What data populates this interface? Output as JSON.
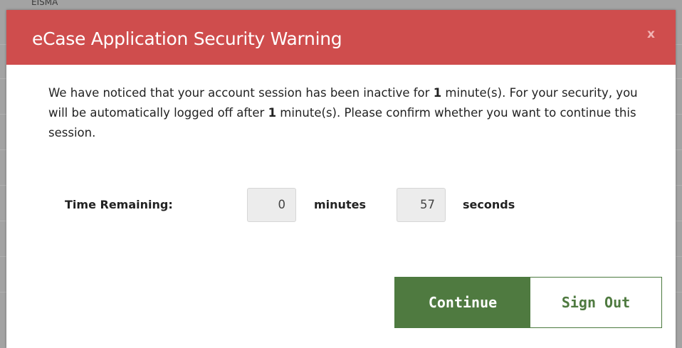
{
  "background": {
    "label": "EISMA"
  },
  "modal": {
    "title": "eCase Application Security Warning",
    "close_label": "x",
    "message": {
      "part1": "We have noticed that your account session has been inactive for ",
      "inactive_minutes": "1",
      "part2": " minute(s). For your security, you will be automatically logged off after ",
      "logoff_minutes": "1",
      "part3": " minute(s). Please confirm whether you want to continue this session."
    },
    "timer": {
      "label": "Time Remaining:",
      "minutes_value": "0",
      "minutes_unit": "minutes",
      "seconds_value": "57",
      "seconds_unit": "seconds"
    },
    "actions": {
      "continue_label": "Continue",
      "signout_label": "Sign Out"
    }
  },
  "colors": {
    "header": "#cf4d4d",
    "continue_bg": "#4f7a40",
    "signout_text": "#4f7a40"
  }
}
